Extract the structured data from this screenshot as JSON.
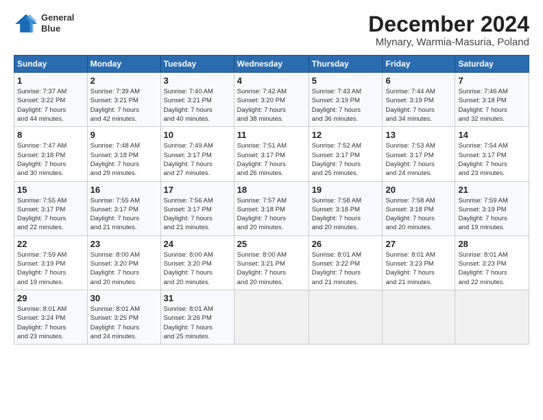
{
  "header": {
    "logo_line1": "General",
    "logo_line2": "Blue",
    "month": "December 2024",
    "location": "Mlynary, Warmia-Masuria, Poland"
  },
  "weekdays": [
    "Sunday",
    "Monday",
    "Tuesday",
    "Wednesday",
    "Thursday",
    "Friday",
    "Saturday"
  ],
  "weeks": [
    [
      {
        "day": "1",
        "info": "Sunrise: 7:37 AM\nSunset: 3:22 PM\nDaylight: 7 hours\nand 44 minutes."
      },
      {
        "day": "2",
        "info": "Sunrise: 7:39 AM\nSunset: 3:21 PM\nDaylight: 7 hours\nand 42 minutes."
      },
      {
        "day": "3",
        "info": "Sunrise: 7:40 AM\nSunset: 3:21 PM\nDaylight: 7 hours\nand 40 minutes."
      },
      {
        "day": "4",
        "info": "Sunrise: 7:42 AM\nSunset: 3:20 PM\nDaylight: 7 hours\nand 38 minutes."
      },
      {
        "day": "5",
        "info": "Sunrise: 7:43 AM\nSunset: 3:19 PM\nDaylight: 7 hours\nand 36 minutes."
      },
      {
        "day": "6",
        "info": "Sunrise: 7:44 AM\nSunset: 3:19 PM\nDaylight: 7 hours\nand 34 minutes."
      },
      {
        "day": "7",
        "info": "Sunrise: 7:46 AM\nSunset: 3:18 PM\nDaylight: 7 hours\nand 32 minutes."
      }
    ],
    [
      {
        "day": "8",
        "info": "Sunrise: 7:47 AM\nSunset: 3:18 PM\nDaylight: 7 hours\nand 30 minutes."
      },
      {
        "day": "9",
        "info": "Sunrise: 7:48 AM\nSunset: 3:18 PM\nDaylight: 7 hours\nand 29 minutes."
      },
      {
        "day": "10",
        "info": "Sunrise: 7:49 AM\nSunset: 3:17 PM\nDaylight: 7 hours\nand 27 minutes."
      },
      {
        "day": "11",
        "info": "Sunrise: 7:51 AM\nSunset: 3:17 PM\nDaylight: 7 hours\nand 26 minutes."
      },
      {
        "day": "12",
        "info": "Sunrise: 7:52 AM\nSunset: 3:17 PM\nDaylight: 7 hours\nand 25 minutes."
      },
      {
        "day": "13",
        "info": "Sunrise: 7:53 AM\nSunset: 3:17 PM\nDaylight: 7 hours\nand 24 minutes."
      },
      {
        "day": "14",
        "info": "Sunrise: 7:54 AM\nSunset: 3:17 PM\nDaylight: 7 hours\nand 23 minutes."
      }
    ],
    [
      {
        "day": "15",
        "info": "Sunrise: 7:55 AM\nSunset: 3:17 PM\nDaylight: 7 hours\nand 22 minutes."
      },
      {
        "day": "16",
        "info": "Sunrise: 7:55 AM\nSunset: 3:17 PM\nDaylight: 7 hours\nand 21 minutes."
      },
      {
        "day": "17",
        "info": "Sunrise: 7:56 AM\nSunset: 3:17 PM\nDaylight: 7 hours\nand 21 minutes."
      },
      {
        "day": "18",
        "info": "Sunrise: 7:57 AM\nSunset: 3:18 PM\nDaylight: 7 hours\nand 20 minutes."
      },
      {
        "day": "19",
        "info": "Sunrise: 7:58 AM\nSunset: 3:18 PM\nDaylight: 7 hours\nand 20 minutes."
      },
      {
        "day": "20",
        "info": "Sunrise: 7:58 AM\nSunset: 3:18 PM\nDaylight: 7 hours\nand 20 minutes."
      },
      {
        "day": "21",
        "info": "Sunrise: 7:59 AM\nSunset: 3:19 PM\nDaylight: 7 hours\nand 19 minutes."
      }
    ],
    [
      {
        "day": "22",
        "info": "Sunrise: 7:59 AM\nSunset: 3:19 PM\nDaylight: 7 hours\nand 19 minutes."
      },
      {
        "day": "23",
        "info": "Sunrise: 8:00 AM\nSunset: 3:20 PM\nDaylight: 7 hours\nand 20 minutes."
      },
      {
        "day": "24",
        "info": "Sunrise: 8:00 AM\nSunset: 3:20 PM\nDaylight: 7 hours\nand 20 minutes."
      },
      {
        "day": "25",
        "info": "Sunrise: 8:00 AM\nSunset: 3:21 PM\nDaylight: 7 hours\nand 20 minutes."
      },
      {
        "day": "26",
        "info": "Sunrise: 8:01 AM\nSunset: 3:22 PM\nDaylight: 7 hours\nand 21 minutes."
      },
      {
        "day": "27",
        "info": "Sunrise: 8:01 AM\nSunset: 3:23 PM\nDaylight: 7 hours\nand 21 minutes."
      },
      {
        "day": "28",
        "info": "Sunrise: 8:01 AM\nSunset: 3:23 PM\nDaylight: 7 hours\nand 22 minutes."
      }
    ],
    [
      {
        "day": "29",
        "info": "Sunrise: 8:01 AM\nSunset: 3:24 PM\nDaylight: 7 hours\nand 23 minutes."
      },
      {
        "day": "30",
        "info": "Sunrise: 8:01 AM\nSunset: 3:25 PM\nDaylight: 7 hours\nand 24 minutes."
      },
      {
        "day": "31",
        "info": "Sunrise: 8:01 AM\nSunset: 3:26 PM\nDaylight: 7 hours\nand 25 minutes."
      },
      {
        "day": "",
        "info": ""
      },
      {
        "day": "",
        "info": ""
      },
      {
        "day": "",
        "info": ""
      },
      {
        "day": "",
        "info": ""
      }
    ]
  ]
}
